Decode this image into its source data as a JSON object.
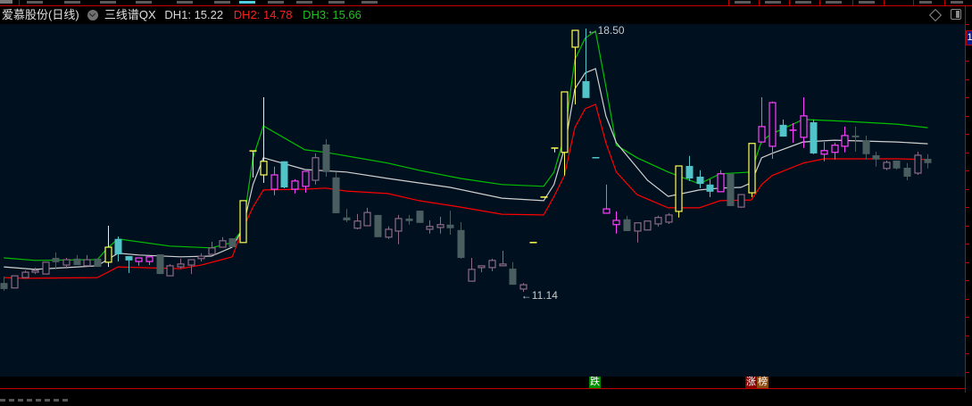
{
  "header": {
    "stock_name": "爱慕股份(日线)",
    "indicator_name": "三线谱QX",
    "dh1": "DH1: 15.22",
    "dh2": "DH2: 14.78",
    "dh3": "DH3: 15.66",
    "axis_badge": "1"
  },
  "signals": {
    "fall_tag": "跌",
    "rise_tag": "涨",
    "rank_tag": "榜"
  },
  "colors": {
    "background": "#00101f",
    "dh3_line": "#00c000",
    "dh1_line": "#d0d0d0",
    "dh2_line": "#ff0000",
    "style_Y": "#ffff50",
    "style_M": "#ff40ff",
    "style_P": "#8c6a84",
    "style_C": "#50c4c8",
    "style_G": "#4a5e60",
    "fall_tag": "#008a00",
    "rise_tag": "#8a0000",
    "rank_tag": "#8a4a10"
  },
  "chart_data": {
    "type": "candlestick",
    "title": "爱慕股份(日线)",
    "ylim": [
      8.78,
      18.63
    ],
    "fields": [
      "open",
      "high",
      "low",
      "close",
      "style"
    ],
    "max_label": "18.50",
    "min_label": "11.14",
    "candles": [
      [
        11.39,
        11.57,
        11.17,
        11.22,
        "G"
      ],
      [
        11.25,
        11.59,
        11.25,
        11.59,
        "P"
      ],
      [
        11.54,
        11.74,
        11.54,
        11.69,
        "P"
      ],
      [
        11.69,
        11.82,
        11.64,
        11.74,
        "P"
      ],
      [
        11.64,
        11.97,
        11.64,
        11.97,
        "P"
      ],
      [
        12.09,
        12.24,
        11.77,
        11.97,
        "G"
      ],
      [
        11.89,
        12.09,
        11.79,
        12.04,
        "P"
      ],
      [
        12.07,
        12.17,
        11.89,
        11.89,
        "G"
      ],
      [
        11.87,
        12.17,
        11.87,
        12.04,
        "P"
      ],
      [
        12.07,
        12.07,
        11.84,
        11.84,
        "G"
      ],
      [
        11.97,
        12.99,
        11.84,
        12.39,
        "Y"
      ],
      [
        12.62,
        12.69,
        11.99,
        12.19,
        "C"
      ],
      [
        12.14,
        12.14,
        11.67,
        12.02,
        "C"
      ],
      [
        11.99,
        12.09,
        11.87,
        12.09,
        "M"
      ],
      [
        11.99,
        12.12,
        11.89,
        12.12,
        "M"
      ],
      [
        12.19,
        12.19,
        11.64,
        11.64,
        "G"
      ],
      [
        11.59,
        11.92,
        11.59,
        11.87,
        "P"
      ],
      [
        11.84,
        12.07,
        11.79,
        11.92,
        "P"
      ],
      [
        11.89,
        12.04,
        11.64,
        12.04,
        "P"
      ],
      [
        12.07,
        12.22,
        11.99,
        12.14,
        "P"
      ],
      [
        12.19,
        12.54,
        12.19,
        12.37,
        "P"
      ],
      [
        12.39,
        12.67,
        12.39,
        12.57,
        "P"
      ],
      [
        12.64,
        12.64,
        12.37,
        12.39,
        "G"
      ],
      [
        12.52,
        13.69,
        12.52,
        13.69,
        "Y"
      ],
      [
        15.08,
        15.08,
        14.34,
        15.08,
        "Y"
      ],
      [
        14.41,
        16.58,
        14.19,
        14.79,
        "Y"
      ],
      [
        14.01,
        14.64,
        13.84,
        14.41,
        "M"
      ],
      [
        14.79,
        14.79,
        14.04,
        14.06,
        "C"
      ],
      [
        14.01,
        14.29,
        13.89,
        14.24,
        "M"
      ],
      [
        14.09,
        14.51,
        13.91,
        14.51,
        "M"
      ],
      [
        14.26,
        15.01,
        14.14,
        14.89,
        "P"
      ],
      [
        15.26,
        15.41,
        14.36,
        14.49,
        "G"
      ],
      [
        14.34,
        14.49,
        13.34,
        13.34,
        "G"
      ],
      [
        13.22,
        13.46,
        13.09,
        13.14,
        "G"
      ],
      [
        12.92,
        13.32,
        12.89,
        13.12,
        "P"
      ],
      [
        12.99,
        13.49,
        12.99,
        13.36,
        "P"
      ],
      [
        13.29,
        13.29,
        12.67,
        12.67,
        "G"
      ],
      [
        12.67,
        12.97,
        12.62,
        12.89,
        "P"
      ],
      [
        12.84,
        13.29,
        12.47,
        13.19,
        "P"
      ],
      [
        13.19,
        13.29,
        13.02,
        13.12,
        "G"
      ],
      [
        13.41,
        13.41,
        13.07,
        13.07,
        "G"
      ],
      [
        12.89,
        13.14,
        12.77,
        12.97,
        "P"
      ],
      [
        12.94,
        13.24,
        12.77,
        13.02,
        "P"
      ],
      [
        13.02,
        13.41,
        12.74,
        12.92,
        "G"
      ],
      [
        12.87,
        13.09,
        12.07,
        12.09,
        "G"
      ],
      [
        11.44,
        12.09,
        11.44,
        11.77,
        "P"
      ],
      [
        11.82,
        11.87,
        11.69,
        11.87,
        "P"
      ],
      [
        11.82,
        12.07,
        11.72,
        12.02,
        "P"
      ],
      [
        11.87,
        12.29,
        11.87,
        11.92,
        "P"
      ],
      [
        11.79,
        11.97,
        11.34,
        11.34,
        "G"
      ],
      [
        11.22,
        11.39,
        11.14,
        11.34,
        "P"
      ],
      [
        12.52,
        12.52,
        12.52,
        12.52,
        "Y"
      ],
      [
        13.79,
        13.79,
        13.79,
        13.79,
        "Y"
      ],
      [
        15.16,
        15.16,
        15.04,
        15.16,
        "Y"
      ],
      [
        15.04,
        16.73,
        14.39,
        16.73,
        "Y"
      ],
      [
        17.98,
        18.45,
        16.38,
        18.45,
        "Y"
      ],
      [
        17.03,
        18.5,
        16.56,
        16.56,
        "C"
      ],
      [
        14.89,
        14.89,
        14.89,
        14.89,
        "C"
      ],
      [
        13.34,
        14.14,
        13.34,
        13.46,
        "M"
      ],
      [
        13.02,
        13.39,
        12.77,
        13.14,
        "M"
      ],
      [
        13.17,
        13.27,
        12.84,
        12.84,
        "G"
      ],
      [
        12.84,
        13.07,
        12.52,
        13.07,
        "P"
      ],
      [
        12.87,
        13.12,
        12.87,
        13.12,
        "P"
      ],
      [
        13.04,
        13.27,
        12.97,
        13.22,
        "P"
      ],
      [
        13.09,
        13.34,
        13.04,
        13.29,
        "P"
      ],
      [
        13.39,
        14.66,
        13.22,
        14.66,
        "Y"
      ],
      [
        14.66,
        14.94,
        14.24,
        14.31,
        "C"
      ],
      [
        14.36,
        14.54,
        14.04,
        14.16,
        "C"
      ],
      [
        14.14,
        14.29,
        13.79,
        13.94,
        "C"
      ],
      [
        13.94,
        14.54,
        13.94,
        14.44,
        "M"
      ],
      [
        14.44,
        14.44,
        13.54,
        13.54,
        "G"
      ],
      [
        13.51,
        13.86,
        13.49,
        13.86,
        "P"
      ],
      [
        13.91,
        15.29,
        13.79,
        15.29,
        "Y"
      ],
      [
        15.33,
        16.58,
        15.33,
        15.76,
        "M"
      ],
      [
        15.21,
        16.46,
        14.86,
        16.43,
        "M"
      ],
      [
        15.81,
        15.96,
        15.48,
        15.48,
        "C"
      ],
      [
        15.63,
        15.86,
        15.31,
        15.66,
        "M"
      ],
      [
        15.46,
        16.58,
        15.16,
        16.06,
        "M"
      ],
      [
        15.88,
        15.96,
        14.99,
        15.01,
        "C"
      ],
      [
        14.99,
        15.33,
        14.79,
        15.09,
        "M"
      ],
      [
        15.04,
        15.31,
        14.84,
        15.24,
        "M"
      ],
      [
        15.21,
        15.76,
        15.04,
        15.51,
        "M"
      ],
      [
        15.51,
        15.76,
        15.06,
        15.46,
        "G"
      ],
      [
        15.38,
        15.51,
        14.84,
        14.99,
        "G"
      ],
      [
        14.96,
        15.06,
        14.64,
        14.84,
        "G"
      ],
      [
        14.59,
        14.81,
        14.54,
        14.76,
        "P"
      ],
      [
        14.81,
        14.81,
        14.56,
        14.59,
        "G"
      ],
      [
        14.61,
        14.74,
        14.26,
        14.36,
        "G"
      ],
      [
        14.46,
        15.06,
        14.41,
        14.96,
        "P"
      ],
      [
        14.86,
        14.99,
        14.59,
        14.74,
        "G"
      ]
    ],
    "series": [
      {
        "name": "DH3",
        "keypoints": [
          [
            0,
            12.09
          ],
          [
            3,
            12.02
          ],
          [
            9,
            12.04
          ],
          [
            10,
            12.37
          ],
          [
            11,
            12.62
          ],
          [
            16,
            12.42
          ],
          [
            20,
            12.37
          ],
          [
            22,
            12.52
          ],
          [
            23,
            12.89
          ],
          [
            24,
            14.89
          ],
          [
            25,
            15.78
          ],
          [
            29,
            15.11
          ],
          [
            31,
            15.04
          ],
          [
            37,
            14.74
          ],
          [
            40,
            14.54
          ],
          [
            44,
            14.31
          ],
          [
            48,
            14.14
          ],
          [
            52,
            14.09
          ],
          [
            53,
            14.49
          ],
          [
            54,
            15.48
          ],
          [
            55,
            17.63
          ],
          [
            56,
            18.23
          ],
          [
            57,
            18.43
          ],
          [
            58,
            16.88
          ],
          [
            59,
            15.24
          ],
          [
            61,
            14.89
          ],
          [
            64,
            14.49
          ],
          [
            67,
            14.16
          ],
          [
            69,
            14.44
          ],
          [
            72,
            14.49
          ],
          [
            73,
            15.36
          ],
          [
            74,
            15.56
          ],
          [
            77,
            15.96
          ],
          [
            81,
            15.91
          ],
          [
            86,
            15.83
          ],
          [
            89,
            15.73
          ]
        ]
      },
      {
        "name": "DH1",
        "keypoints": [
          [
            0,
            11.84
          ],
          [
            3,
            11.77
          ],
          [
            9,
            11.87
          ],
          [
            11,
            12.22
          ],
          [
            13,
            12.17
          ],
          [
            17,
            12.12
          ],
          [
            20,
            12.14
          ],
          [
            22,
            12.39
          ],
          [
            23,
            12.89
          ],
          [
            24,
            14.14
          ],
          [
            25,
            14.89
          ],
          [
            29,
            14.56
          ],
          [
            33,
            14.49
          ],
          [
            37,
            14.31
          ],
          [
            43,
            14.06
          ],
          [
            48,
            13.76
          ],
          [
            52,
            13.69
          ],
          [
            53,
            14.14
          ],
          [
            54,
            15.14
          ],
          [
            55,
            16.81
          ],
          [
            56,
            17.26
          ],
          [
            57,
            17.38
          ],
          [
            58,
            16.06
          ],
          [
            59,
            15.31
          ],
          [
            62,
            14.26
          ],
          [
            64,
            13.81
          ],
          [
            67,
            13.99
          ],
          [
            69,
            14.04
          ],
          [
            71,
            14.06
          ],
          [
            72,
            14.19
          ],
          [
            73,
            14.89
          ],
          [
            74,
            15.01
          ],
          [
            77,
            15.33
          ],
          [
            80,
            15.38
          ],
          [
            86,
            15.33
          ],
          [
            89,
            15.28
          ]
        ]
      },
      {
        "name": "DH2",
        "keypoints": [
          [
            0,
            11.54
          ],
          [
            2,
            11.52
          ],
          [
            9,
            11.54
          ],
          [
            10,
            11.69
          ],
          [
            11,
            11.84
          ],
          [
            17,
            11.79
          ],
          [
            19,
            11.89
          ],
          [
            21,
            12.04
          ],
          [
            22,
            12.12
          ],
          [
            23,
            12.89
          ],
          [
            24,
            13.51
          ],
          [
            25,
            13.99
          ],
          [
            29,
            14.01
          ],
          [
            31,
            14.04
          ],
          [
            33,
            13.96
          ],
          [
            37,
            13.89
          ],
          [
            40,
            13.69
          ],
          [
            44,
            13.51
          ],
          [
            48,
            13.31
          ],
          [
            52,
            13.29
          ],
          [
            53,
            13.81
          ],
          [
            54,
            14.39
          ],
          [
            55,
            15.73
          ],
          [
            56,
            16.26
          ],
          [
            57,
            16.38
          ],
          [
            58,
            15.31
          ],
          [
            59,
            14.49
          ],
          [
            61,
            13.86
          ],
          [
            64,
            13.49
          ],
          [
            67,
            13.49
          ],
          [
            69,
            13.69
          ],
          [
            72,
            13.71
          ],
          [
            73,
            14.14
          ],
          [
            74,
            14.39
          ],
          [
            77,
            14.74
          ],
          [
            79,
            14.86
          ],
          [
            86,
            14.86
          ],
          [
            89,
            14.84
          ]
        ]
      }
    ]
  }
}
